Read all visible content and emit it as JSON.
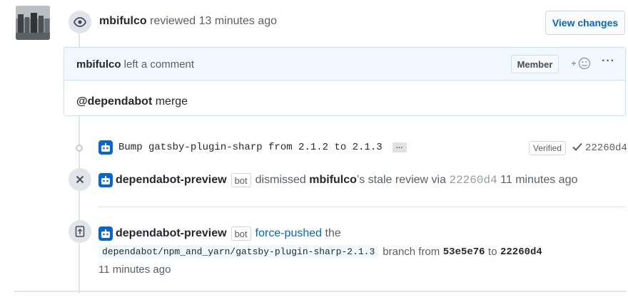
{
  "review": {
    "user": "mbifulco",
    "action": "reviewed",
    "time": "13 minutes ago",
    "view_changes_label": "View changes"
  },
  "comment": {
    "author": "mbifulco",
    "action": "left a comment",
    "role_badge": "Member",
    "reaction_icon": "smiley-plus-icon",
    "more_label": "···",
    "mention": "@dependabot",
    "text": " merge"
  },
  "commit": {
    "message": "Bump gatsby-plugin-sharp from 2.1.2 to 2.1.3",
    "ellipsis": "…",
    "verified_label": "Verified",
    "sha": "22260d4"
  },
  "dismiss": {
    "actor": "dependabot-preview",
    "bot_label": "bot",
    "text1": "dismissed",
    "target": "mbifulco",
    "text2": "’s stale review via",
    "sha": "22260d4",
    "time": "11 minutes ago"
  },
  "force_push": {
    "actor": "dependabot-preview",
    "bot_label": "bot",
    "action": "force-pushed",
    "text1": "the",
    "branch": "dependabot/npm_and_yarn/gatsby-plugin-sharp-2.1.3",
    "text2": "branch from",
    "from_sha": "53e5e76",
    "text3": "to",
    "to_sha": "22260d4",
    "time": "11 minutes ago"
  },
  "colors": {
    "link": "#0366d6",
    "bot": "#0366d6",
    "comment_header_bg": "#f1f8ff"
  }
}
